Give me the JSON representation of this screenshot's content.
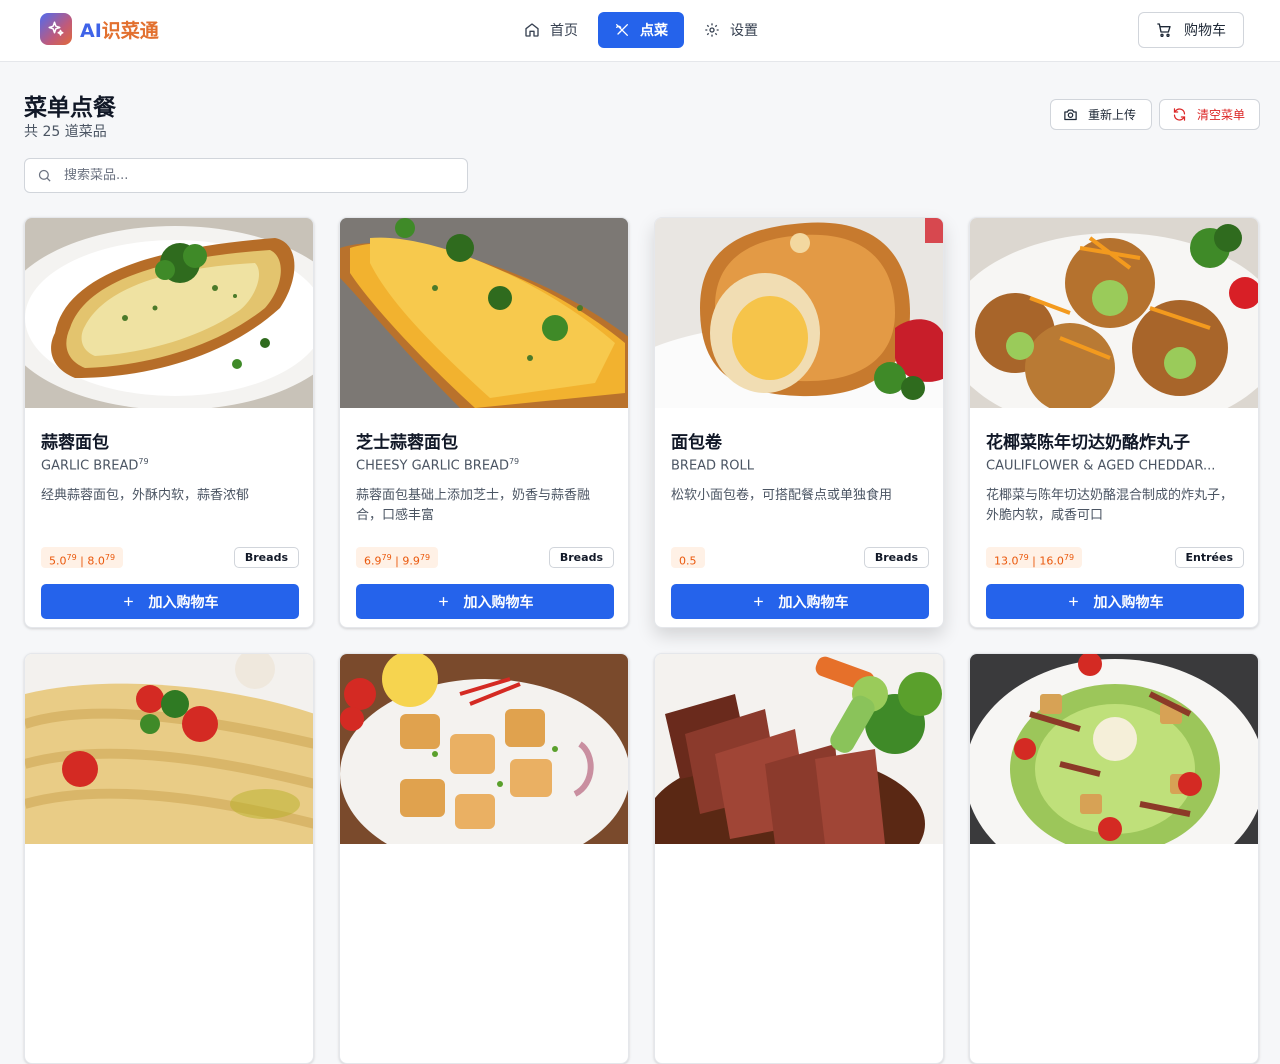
{
  "app": {
    "logo_ai": "AI",
    "logo_rest": "识菜通"
  },
  "nav": [
    {
      "label": "首页",
      "icon": "home-icon",
      "active": false
    },
    {
      "label": "点菜",
      "icon": "utensils-icon",
      "active": true
    },
    {
      "label": "设置",
      "icon": "gear-icon",
      "active": false
    }
  ],
  "header": {
    "cart_label": "购物车"
  },
  "page": {
    "title": "菜单点餐",
    "subtitle": "共 25 道菜品",
    "reupload_label": "重新上传",
    "clear_label": "清空菜单",
    "search_placeholder": "搜索菜品..."
  },
  "colors": {
    "accent": "#2563eb",
    "price_text": "#ea580c",
    "price_bg": "#fff1e6",
    "danger": "#dc2626"
  },
  "add_label": "加入购物车",
  "dishes": [
    {
      "name": "蒜蓉面包",
      "en": "GARLIC BREAD",
      "en_sup": "79",
      "desc": "经典蒜蓉面包，外酥内软，蒜香浓郁",
      "price_parts": [
        "5.0",
        "79",
        " | 8.0",
        "79"
      ],
      "category": "Breads"
    },
    {
      "name": "芝士蒜蓉面包",
      "en": "CHEESY GARLIC BREAD",
      "en_sup": "79",
      "desc": "蒜蓉面包基础上添加芝士，奶香与蒜香融合，口感丰富",
      "price_parts": [
        "6.9",
        "79",
        " | 9.9",
        "79"
      ],
      "category": "Breads"
    },
    {
      "name": "面包卷",
      "en": "BREAD ROLL",
      "en_sup": "",
      "desc": "松软小面包卷，可搭配餐点或单独食用",
      "price_parts": [
        "0.5",
        "",
        "",
        ""
      ],
      "category": "Breads"
    },
    {
      "name": "花椰菜陈年切达奶酪炸丸子",
      "en": "CAULIFLOWER & AGED CHEDDAR...",
      "en_sup": "",
      "desc": "花椰菜与陈年切达奶酪混合制成的炸丸子，外脆内软，咸香可口",
      "price_parts": [
        "13.0",
        "79",
        " | 16.0",
        "79"
      ],
      "category": "Entrées"
    }
  ],
  "row2_images": [
    "pasta-image",
    "fried-calamari-image",
    "steak-image",
    "caesar-salad-image"
  ]
}
